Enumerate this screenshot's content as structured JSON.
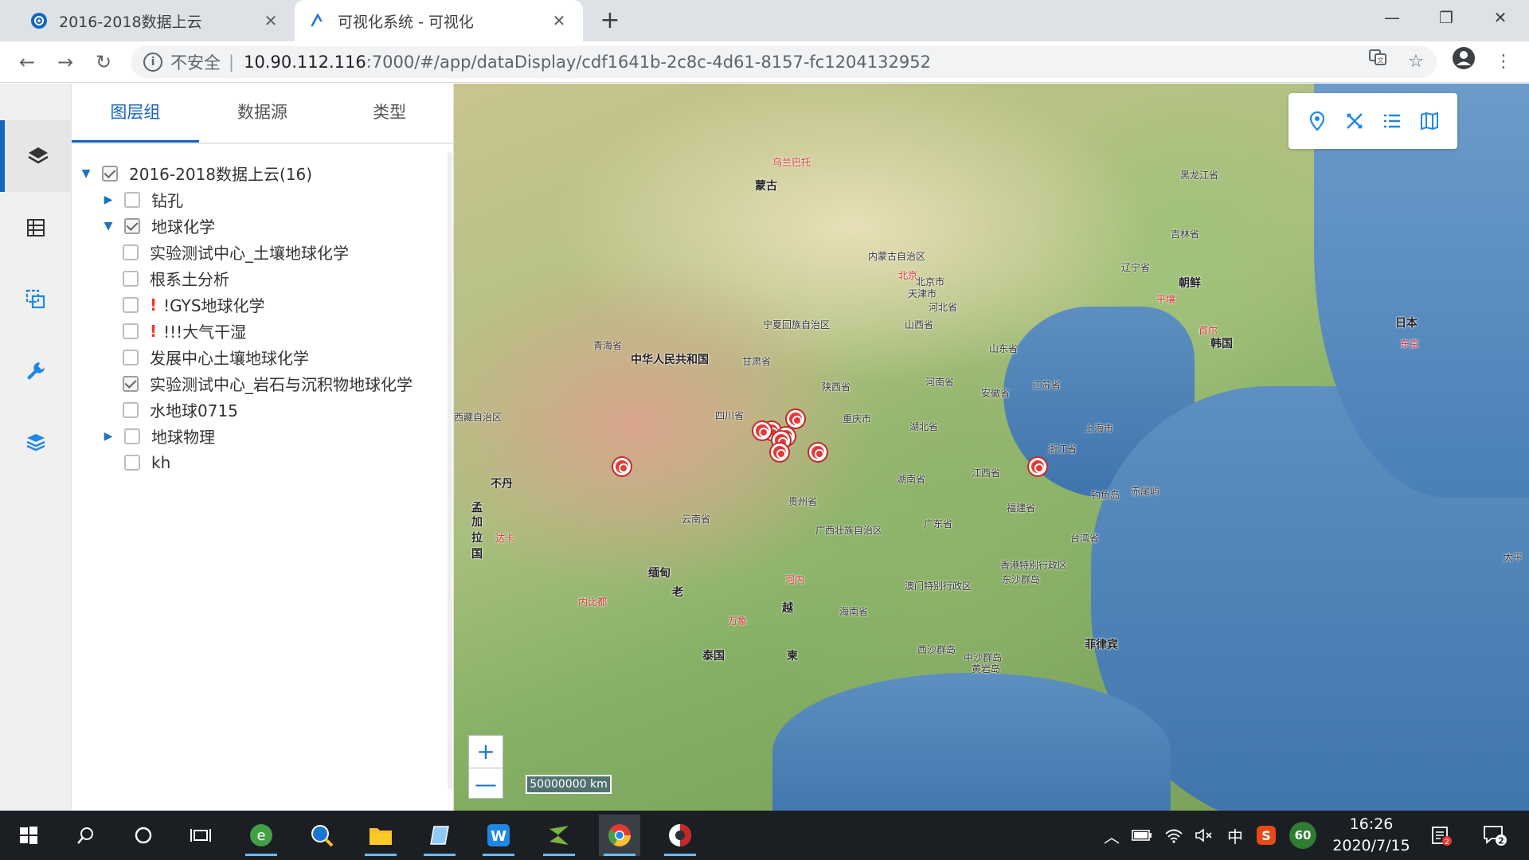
{
  "browser": {
    "tabs": [
      {
        "title": "2016-2018数据上云",
        "active": false
      },
      {
        "title": "可视化系统 - 可视化",
        "active": true
      }
    ],
    "new_tab": "+",
    "security_label": "不安全",
    "url_host": "10.90.112.116",
    "url_rest": ":7000/#/app/dataDisplay/cdf1641b-2c8c-4d61-8157-fc1204132952",
    "window_controls": {
      "minimize": "—",
      "restore": "❐",
      "close": "✕"
    }
  },
  "panel": {
    "tabs": [
      "图层组",
      "数据源",
      "类型"
    ],
    "active_tab": 0,
    "tree": [
      {
        "label": "2016-2018数据上云(16)",
        "level": 0,
        "expand": "expanded",
        "checked": true,
        "warn": false
      },
      {
        "label": "钻孔",
        "level": 1,
        "expand": "collapsed",
        "checked": false,
        "warn": false
      },
      {
        "label": "地球化学",
        "level": 1,
        "expand": "expanded",
        "checked": true,
        "warn": false
      },
      {
        "label": "实验测试中心_土壤地球化学",
        "level": 2,
        "expand": "none",
        "checked": false,
        "warn": false
      },
      {
        "label": "根系土分析",
        "level": 2,
        "expand": "none",
        "checked": false,
        "warn": false
      },
      {
        "label": "!GYS地球化学",
        "level": 2,
        "expand": "none",
        "checked": false,
        "warn": true
      },
      {
        "label": "!!!大气干湿",
        "level": 2,
        "expand": "none",
        "checked": false,
        "warn": true
      },
      {
        "label": "发展中心土壤地球化学",
        "level": 2,
        "expand": "none",
        "checked": false,
        "warn": false
      },
      {
        "label": "实验测试中心_岩石与沉积物地球化学",
        "level": 2,
        "expand": "none",
        "checked": true,
        "warn": false
      },
      {
        "label": "水地球0715",
        "level": 2,
        "expand": "none",
        "checked": false,
        "warn": false
      },
      {
        "label": "地球物理",
        "level": 1,
        "expand": "collapsed",
        "checked": false,
        "warn": false
      },
      {
        "label": "kh",
        "level": 1,
        "expand": "none",
        "checked": false,
        "warn": false
      }
    ],
    "warn_mark": "!"
  },
  "map": {
    "labels": [
      {
        "text": "蒙古",
        "big": true,
        "red": false
      },
      {
        "text": "乌兰巴托",
        "big": false,
        "red": true
      },
      {
        "text": "黑龙江省",
        "big": false,
        "red": false
      },
      {
        "text": "吉林省",
        "big": false,
        "red": false
      },
      {
        "text": "内蒙古自治区",
        "big": false,
        "red": false
      },
      {
        "text": "辽宁省",
        "big": false,
        "red": false
      },
      {
        "text": "北京",
        "big": false,
        "red": true
      },
      {
        "text": "北京市",
        "big": false,
        "red": false
      },
      {
        "text": "天津市",
        "big": false,
        "red": false
      },
      {
        "text": "朝鲜",
        "big": true,
        "red": false
      },
      {
        "text": "平壤",
        "big": false,
        "red": true
      },
      {
        "text": "河北省",
        "big": false,
        "red": false
      },
      {
        "text": "首尔",
        "big": false,
        "red": true
      },
      {
        "text": "韩国",
        "big": true,
        "red": false
      },
      {
        "text": "日本",
        "big": true,
        "red": false
      },
      {
        "text": "东京",
        "big": false,
        "red": true
      },
      {
        "text": "宁夏回族自治区",
        "big": false,
        "red": false
      },
      {
        "text": "山西省",
        "big": false,
        "red": false
      },
      {
        "text": "山东省",
        "big": false,
        "red": false
      },
      {
        "text": "青海省",
        "big": false,
        "red": false
      },
      {
        "text": "中华人民共和国",
        "big": true,
        "red": false
      },
      {
        "text": "甘肃省",
        "big": false,
        "red": false
      },
      {
        "text": "河南省",
        "big": false,
        "red": false
      },
      {
        "text": "江苏省",
        "big": false,
        "red": false
      },
      {
        "text": "陕西省",
        "big": false,
        "red": false
      },
      {
        "text": "安徽省",
        "big": false,
        "red": false
      },
      {
        "text": "四川省",
        "big": false,
        "red": false
      },
      {
        "text": "重庆市",
        "big": false,
        "red": false
      },
      {
        "text": "湖北省",
        "big": false,
        "red": false
      },
      {
        "text": "上海市",
        "big": false,
        "red": false
      },
      {
        "text": "浙江省",
        "big": false,
        "red": false
      },
      {
        "text": "西藏自治区",
        "big": false,
        "red": false
      },
      {
        "text": "不丹",
        "big": true,
        "red": false
      },
      {
        "text": "江西省",
        "big": false,
        "red": false
      },
      {
        "text": "湖南省",
        "big": false,
        "red": false
      },
      {
        "text": "钓鱼岛",
        "big": false,
        "red": false
      },
      {
        "text": "赤尾屿",
        "big": false,
        "red": false
      },
      {
        "text": "福建省",
        "big": false,
        "red": false
      },
      {
        "text": "贵州省",
        "big": false,
        "red": false
      },
      {
        "text": "孟",
        "big": true,
        "red": false
      },
      {
        "text": "加",
        "big": true,
        "red": false
      },
      {
        "text": "拉",
        "big": true,
        "red": false
      },
      {
        "text": "国",
        "big": true,
        "red": false
      },
      {
        "text": "达卡",
        "big": false,
        "red": true
      },
      {
        "text": "云南省",
        "big": false,
        "red": false
      },
      {
        "text": "广西壮族自治区",
        "big": false,
        "red": false
      },
      {
        "text": "广东省",
        "big": false,
        "red": false
      },
      {
        "text": "台湾省",
        "big": false,
        "red": false
      },
      {
        "text": "香港特别行政区",
        "big": false,
        "red": false
      },
      {
        "text": "东沙群岛",
        "big": false,
        "red": false
      },
      {
        "text": "澳门特别行政区",
        "big": false,
        "red": false
      },
      {
        "text": "缅甸",
        "big": true,
        "red": false
      },
      {
        "text": "河内",
        "big": false,
        "red": true
      },
      {
        "text": "老",
        "big": true,
        "red": false
      },
      {
        "text": "内比都",
        "big": false,
        "red": true
      },
      {
        "text": "越",
        "big": true,
        "red": false
      },
      {
        "text": "海南省",
        "big": false,
        "red": false
      },
      {
        "text": "万象",
        "big": false,
        "red": true
      },
      {
        "text": "菲律宾",
        "big": true,
        "red": false
      },
      {
        "text": "泰国",
        "big": true,
        "red": false
      },
      {
        "text": "柬",
        "big": true,
        "red": false
      },
      {
        "text": "西沙群岛",
        "big": false,
        "red": false
      },
      {
        "text": "中沙群岛",
        "big": false,
        "red": false
      },
      {
        "text": "黄岩岛",
        "big": false,
        "red": false
      },
      {
        "text": "太平",
        "big": false,
        "red": false
      }
    ],
    "markers": 9,
    "zoom_in": "+",
    "zoom_out": "—",
    "scale": "50000000 km"
  },
  "taskbar": {
    "ime": "中",
    "badge": "60",
    "time": "16:26",
    "date": "2020/7/15",
    "notification_count": "2"
  },
  "colors": {
    "accent": "#1565c0",
    "marker": "#e53935"
  }
}
